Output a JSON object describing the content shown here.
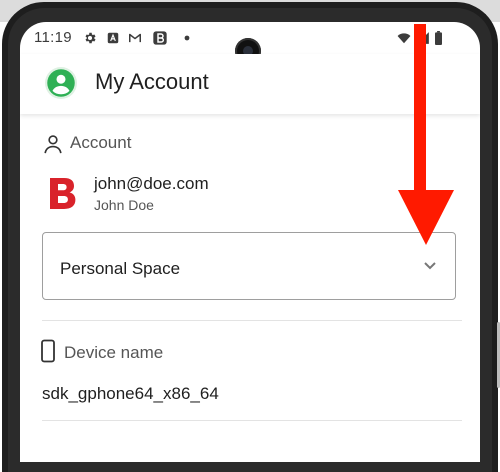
{
  "status_bar": {
    "time": "11:19",
    "icons": [
      "gear-icon",
      "a-square-icon",
      "gmail-icon",
      "b-square-icon",
      "dot-icon",
      "wifi-icon",
      "signal-icon",
      "battery-icon"
    ]
  },
  "app_bar": {
    "title": "My Account",
    "avatar_icon": "account-circle-icon",
    "avatar_color": "#2fb055"
  },
  "account_section": {
    "header": "Account",
    "header_icon": "person-outline-icon",
    "email": "john@doe.com",
    "name": "John Doe",
    "logo_icon": "b-brand-logo",
    "logo_color": "#d9232b"
  },
  "space_select": {
    "value": "Personal Space",
    "icon": "chevron-down-icon"
  },
  "device_section": {
    "header": "Device name",
    "header_icon": "smartphone-outline-icon",
    "value": "sdk_gphone64_x86_64"
  },
  "annotation": {
    "arrow_icon": "red-down-arrow",
    "arrow_color": "#ff1a00"
  }
}
